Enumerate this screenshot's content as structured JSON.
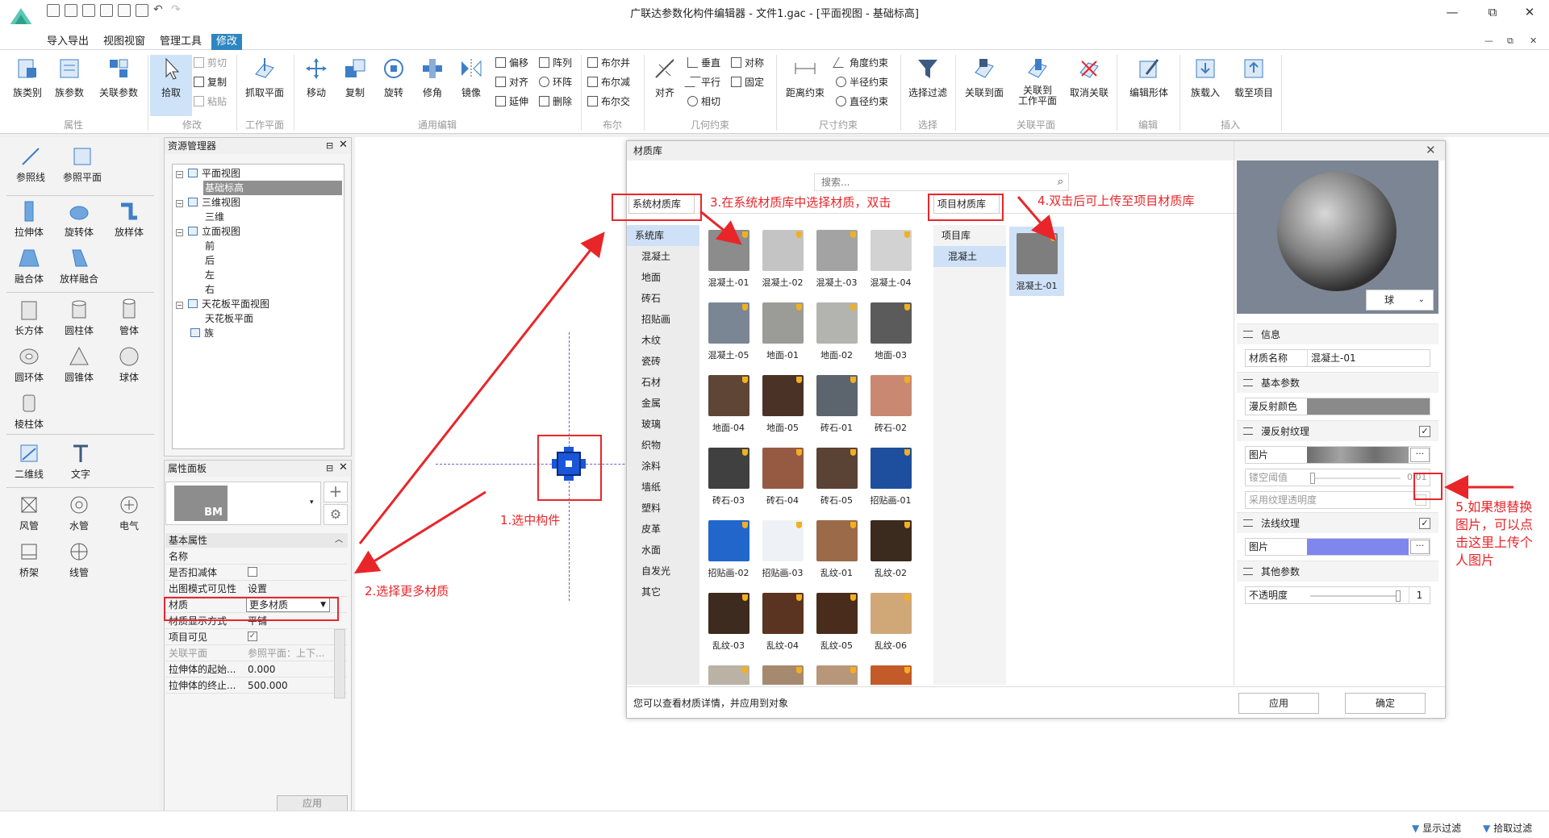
{
  "window": {
    "title": "广联达参数化构件编辑器 - 文件1.gac - [平面视图 - 基础标高]",
    "min_label": "—",
    "restore_label": "⧉",
    "close_label": "✕",
    "doc_min_label": "—",
    "doc_restore_label": "⧉",
    "doc_close_label": "✕"
  },
  "menu": {
    "tabs": [
      "导入导出",
      "视图视窗",
      "管理工具",
      "修改"
    ],
    "active": "修改"
  },
  "ribbon": {
    "big_buttons": [
      "族类别",
      "族参数",
      "关联参数",
      "拾取",
      "抓取平面",
      "移动",
      "复制",
      "旋转",
      "修角",
      "镜像",
      "对齐",
      "距离约束",
      "选择过滤",
      "关联到面",
      "关联到\n工作平面",
      "取消关联",
      "编辑形体",
      "族载入",
      "载至项目"
    ],
    "clipboard": [
      "剪切",
      "复制",
      "粘贴"
    ],
    "edit_small": [
      "偏移",
      "阵列",
      "对齐",
      "环阵",
      "延伸",
      "删除"
    ],
    "bool_small": [
      "布尔并",
      "布尔减",
      "布尔交"
    ],
    "geo_small": [
      "垂直",
      "对称",
      "平行",
      "固定",
      "相切"
    ],
    "dim_small": [
      "角度约束",
      "半径约束",
      "直径约束"
    ],
    "groups": [
      "属性",
      "修改",
      "工作平面",
      "通用编辑",
      "布尔",
      "几何约束",
      "尺寸约束",
      "选择",
      "关联平面",
      "编辑",
      "插入"
    ]
  },
  "toolbox": {
    "items": [
      "参照线",
      "参照平面",
      "拉伸体",
      "旋转体",
      "放样体",
      "融合体",
      "放样融合",
      "长方体",
      "圆柱体",
      "管体",
      "圆环体",
      "圆锥体",
      "球体",
      "棱柱体",
      "二维线",
      "文字",
      "风管",
      "水管",
      "电气",
      "桥架",
      "线管"
    ]
  },
  "resource_manager": {
    "title": "资源管理器",
    "nodes": [
      "平面视图",
      "基础标高",
      "三维视图",
      "三维",
      "立面视图",
      "前",
      "后",
      "左",
      "右",
      "天花板平面视图",
      "天花板平面",
      "族"
    ]
  },
  "properties": {
    "title": "属性面板",
    "logo_text": "BM",
    "section": "基本属性",
    "rows": [
      {
        "label": "名称",
        "value": ""
      },
      {
        "label": "是否扣减体",
        "value": ""
      },
      {
        "label": "出图模式可见性",
        "value": "设置"
      },
      {
        "label": "材质",
        "value": "更多材质"
      },
      {
        "label": "材质显示方式",
        "value": "平铺"
      },
      {
        "label": "项目可见",
        "value": ""
      },
      {
        "label": "关联平面",
        "value": "参照平面：上下..."
      },
      {
        "label": "拉伸体的起始...",
        "value": "0.000"
      },
      {
        "label": "拉伸体的终止...",
        "value": "500.000"
      }
    ],
    "apply": "应用"
  },
  "dialog": {
    "title": "材质库",
    "search_placeholder": "搜索...",
    "system_tab": "系统材质库",
    "project_tab": "项目材质库",
    "categories": [
      "系统库",
      "混凝土",
      "地面",
      "砖石",
      "招贴画",
      "木纹",
      "瓷砖",
      "石材",
      "金属",
      "玻璃",
      "织物",
      "涂料",
      "墙纸",
      "塑料",
      "皮革",
      "水面",
      "自发光",
      "其它"
    ],
    "materials": [
      {
        "name": "混凝土-01",
        "color": "#8c8c8c"
      },
      {
        "name": "混凝土-02",
        "color": "#c4c4c4"
      },
      {
        "name": "混凝土-03",
        "color": "#a3a3a3"
      },
      {
        "name": "混凝土-04",
        "color": "#d2d2d2"
      },
      {
        "name": "混凝土-05",
        "color": "#7b8694"
      },
      {
        "name": "地面-01",
        "color": "#9b9b97"
      },
      {
        "name": "地面-02",
        "color": "#b3b3af"
      },
      {
        "name": "地面-03",
        "color": "#5b5b5b"
      },
      {
        "name": "地面-04",
        "color": "#5e4536"
      },
      {
        "name": "地面-05",
        "color": "#4a3326"
      },
      {
        "name": "砖石-01",
        "color": "#5c646d"
      },
      {
        "name": "砖石-02",
        "color": "#c98872"
      },
      {
        "name": "砖石-03",
        "color": "#404040"
      },
      {
        "name": "砖石-04",
        "color": "#965a43"
      },
      {
        "name": "砖石-05",
        "color": "#5a4234"
      },
      {
        "name": "招贴画-01",
        "color": "#1d4f9e"
      },
      {
        "name": "招贴画-02",
        "color": "#2266cc"
      },
      {
        "name": "招贴画-03",
        "color": "#eef2f6"
      },
      {
        "name": "乱纹-01",
        "color": "#9b6a48"
      },
      {
        "name": "乱纹-02",
        "color": "#3b2a1e"
      },
      {
        "name": "乱纹-03",
        "color": "#3d2b1f"
      },
      {
        "name": "乱纹-04",
        "color": "#5b3421"
      },
      {
        "name": "乱纹-05",
        "color": "#4a2c1c"
      },
      {
        "name": "乱纹-06",
        "color": "#d0a878"
      },
      {
        "name": "",
        "color": "#b9b2a5"
      },
      {
        "name": "",
        "color": "#a58a70"
      },
      {
        "name": "",
        "color": "#b8967a"
      },
      {
        "name": "",
        "color": "#c35a2a"
      }
    ],
    "project_categories": [
      "项目库",
      "混凝土"
    ],
    "project_materials": [
      {
        "name": "混凝土-01",
        "color": "#7e7e7e"
      }
    ],
    "preview_shape": "球",
    "info_section": "信息",
    "material_name_label": "材质名称",
    "material_name_value": "混凝土-01",
    "basic_section": "基本参数",
    "diffuse_color_label": "漫反射颜色",
    "diffuse_texture_section": "漫反射纹理",
    "image_label": "图片",
    "cutout_label": "镂空阈值",
    "cutout_value": "0.01",
    "texture_alpha_label": "采用纹理透明度",
    "normal_section": "法线纹理",
    "normal_image_label": "图片",
    "other_section": "其他参数",
    "opacity_label": "不透明度",
    "opacity_value": "1",
    "more_label": "···",
    "hint": "您可以查看材质详情，并应用到对象",
    "apply": "应用",
    "ok": "确定"
  },
  "annotations": [
    "1.选中构件",
    "2.选择更多材质",
    "3.在系统材质库中选择材质，双击",
    "4.双击后可上传至项目材质库",
    "5.如果想替换\n图片，可以点\n击这里上传个\n人图片"
  ],
  "status": {
    "display_filter": "显示过滤",
    "pick_filter": "拾取过滤"
  },
  "colors": {
    "accent": "#2e86c1",
    "annotation": "#e8262a",
    "normal_map": "#7f86ee",
    "diffuse": "#8a8a8a"
  }
}
